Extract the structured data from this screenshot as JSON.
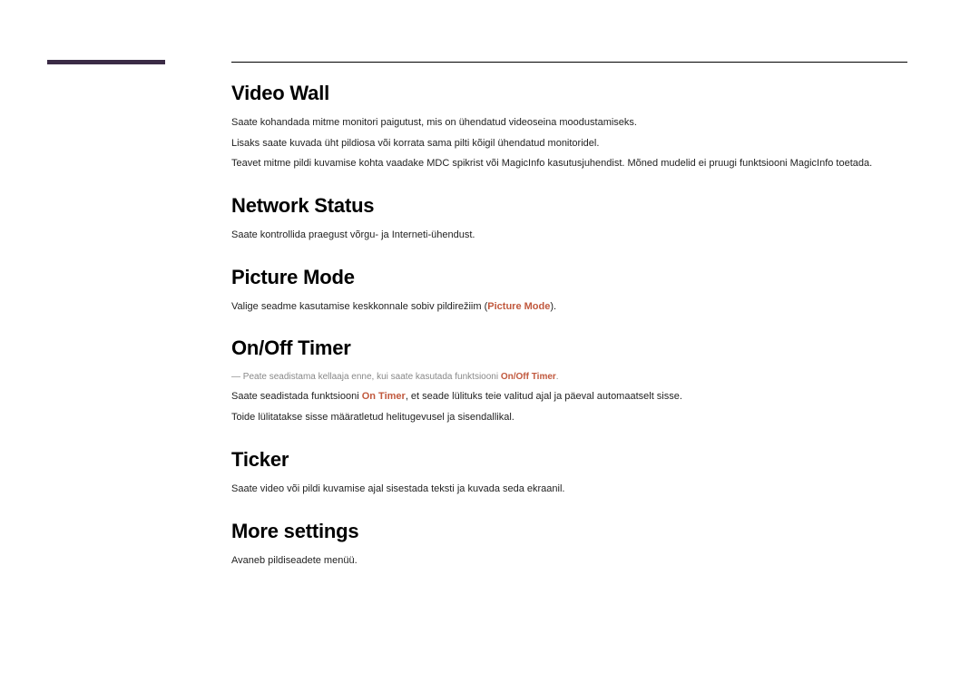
{
  "sections": {
    "video_wall": {
      "title": "Video Wall",
      "p1": "Saate kohandada mitme monitori paigutust, mis on ühendatud videoseina moodustamiseks.",
      "p2": "Lisaks saate kuvada üht pildiosa või korrata sama pilti kõigil ühendatud monitoridel.",
      "p3": "Teavet mitme pildi kuvamise kohta vaadake MDC spikrist või MagicInfo kasutusjuhendist. Mõned mudelid ei pruugi funktsiooni MagicInfo toetada."
    },
    "network_status": {
      "title": "Network Status",
      "p1": "Saate kontrollida praegust võrgu- ja Interneti-ühendust."
    },
    "picture_mode": {
      "title": "Picture Mode",
      "p1_before": "Valige seadme kasutamise keskkonnale sobiv pildirežiim (",
      "p1_accent": "Picture Mode",
      "p1_after": ")."
    },
    "on_off_timer": {
      "title": "On/Off Timer",
      "note_before": "Peate seadistama kellaaja enne, kui saate kasutada funktsiooni ",
      "note_accent": "On/Off Timer",
      "note_after": ".",
      "p1_before": "Saate seadistada funktsiooni ",
      "p1_accent": "On Timer",
      "p1_after": ", et seade lülituks teie valitud ajal ja päeval automaatselt sisse.",
      "p2": "Toide lülitatakse sisse määratletud helitugevusel ja sisendallikal."
    },
    "ticker": {
      "title": "Ticker",
      "p1": "Saate video või pildi kuvamise ajal sisestada teksti ja kuvada seda ekraanil."
    },
    "more_settings": {
      "title": "More settings",
      "p1": "Avaneb pildiseadete menüü."
    }
  }
}
